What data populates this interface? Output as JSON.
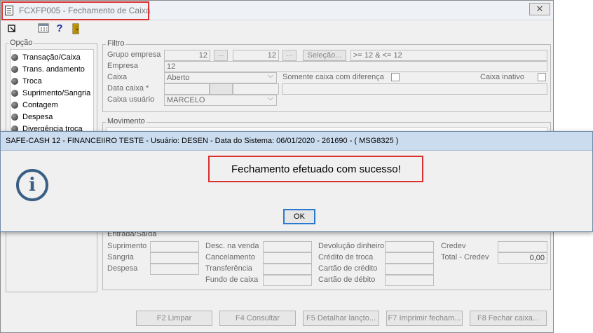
{
  "window": {
    "title": "FCXFP005 - Fechamento de Caixa",
    "close_label": "✕"
  },
  "toolbar": {
    "icons": [
      "export-icon",
      "calculator-icon",
      "help-icon",
      "exit-door-icon"
    ],
    "help_glyph": "?"
  },
  "opcao": {
    "legend": "Opção",
    "items": [
      "Transação/Caixa",
      "Trans. andamento",
      "Troca",
      "Suprimento/Sangria",
      "Contagem",
      "Despesa",
      "Divergência troca"
    ]
  },
  "filtro": {
    "legend": "Filtro",
    "grupo_empresa_label": "Grupo empresa",
    "grupo_empresa_from": "12",
    "grupo_empresa_to": "12",
    "selecao_label": "Seleção...",
    "selecao_expr": ">= 12 & <= 12",
    "empresa_label": "Empresa",
    "empresa_value": "12",
    "caixa_label": "Caixa",
    "caixa_value": "Aberto",
    "somente_dif_label": "Somente caixa com diferença",
    "caixa_inativo_label": "Caixa inativo",
    "data_caixa_label": "Data caixa *",
    "caixa_usuario_label": "Caixa usuário",
    "caixa_usuario_value": "MARCELO"
  },
  "movimento": {
    "legend": "Movimento"
  },
  "entrada_saida": {
    "legend": "Entrada/Saída",
    "col1": [
      "Suprimento",
      "Sangria",
      "Despesa"
    ],
    "col2": [
      "Desc. na venda",
      "Cancelamento",
      "Transferência",
      "Fundo de caixa"
    ],
    "col3": [
      "Devolução dinheiro",
      "Crédito de troca",
      "Cartão de crédito",
      "Cartão de débito"
    ],
    "credev_label": "Credev",
    "total_credev_label": "Total - Credev",
    "total_credev_value": "0,00"
  },
  "buttons": {
    "limpar": "F2 Limpar",
    "consultar": "F4 Consultar",
    "detalhar": "F5 Detalhar lançto...",
    "imprimir": "F7 Imprimir fecham...",
    "fechar": "F8 Fechar caixa..."
  },
  "dialog": {
    "title": "SAFE-CASH 12 - FINANCEIIRO TESTE - Usuário: DESEN - Data do Sistema: 06/01/2020 - 261690 - ( MSG8325 )",
    "message": "Fechamento efetuado com sucesso!",
    "ok_label": "OK",
    "icon_glyph": "i"
  },
  "colors": {
    "highlight_red": "#d93030",
    "dialog_title_bg": "#cbdcee",
    "info_icon": "#3a5f86",
    "ok_focus": "#2a7bd0"
  }
}
